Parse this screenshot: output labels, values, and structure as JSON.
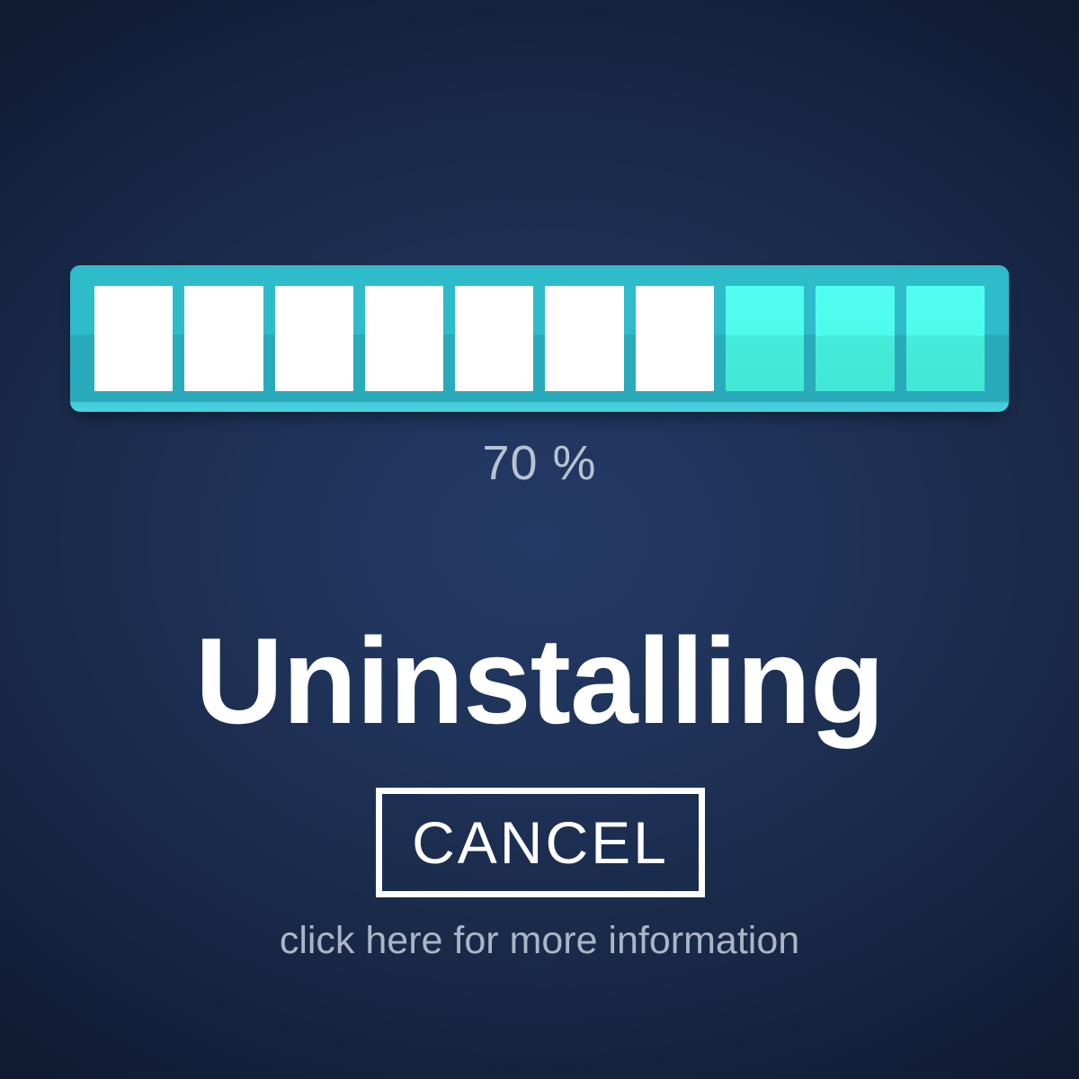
{
  "window": {
    "title": "Uninstalling",
    "background_color_center": "#233a66",
    "background_color_edge": "#101b32"
  },
  "progress": {
    "percent_label": "70 %",
    "percent_value": 70,
    "total_segments": 10,
    "filled_segments": 3,
    "empty_segments": 7,
    "segment_states": [
      "empty",
      "empty",
      "empty",
      "empty",
      "empty",
      "empty",
      "empty",
      "filled",
      "filled",
      "filled"
    ],
    "track_color": "#2fbcca",
    "filled_color": "#4ffbec",
    "empty_color": "#ffffff",
    "percent_text_color": "#b7c3d4"
  },
  "status": {
    "heading": "Uninstalling",
    "heading_color": "#ffffff"
  },
  "actions": {
    "cancel_label": "CANCEL",
    "cancel_border_color": "#ffffff",
    "info_link_label": "click here for more information",
    "info_link_color": "#aab6c8"
  }
}
